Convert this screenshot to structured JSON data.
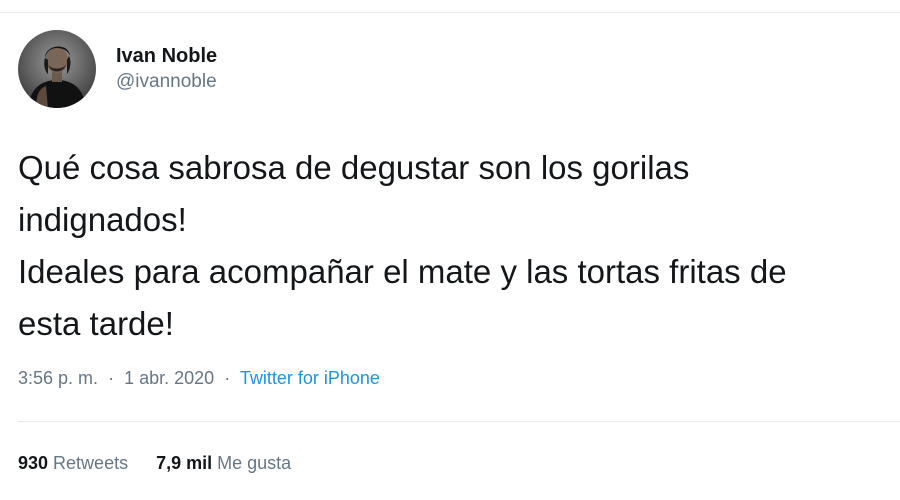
{
  "author": {
    "display_name": "Ivan Noble",
    "handle": "@ivannoble",
    "avatar_icon": "profile-photo"
  },
  "tweet": {
    "lines": [
      "Qué cosa sabrosa de degustar son los gorilas",
      "indignados!",
      "Ideales para acompañar el mate y las tortas fritas de",
      "esta tarde!"
    ]
  },
  "meta": {
    "time": "3:56 p. m.",
    "separator": "·",
    "date": "1 abr. 2020",
    "source": "Twitter for iPhone"
  },
  "stats": {
    "retweets_count": "930",
    "retweets_label": "Retweets",
    "likes_count": "7,9 mil",
    "likes_label": "Me gusta"
  },
  "colors": {
    "link": "#1b95e0",
    "secondary_text": "#657786",
    "divider": "#e6ecf0"
  }
}
